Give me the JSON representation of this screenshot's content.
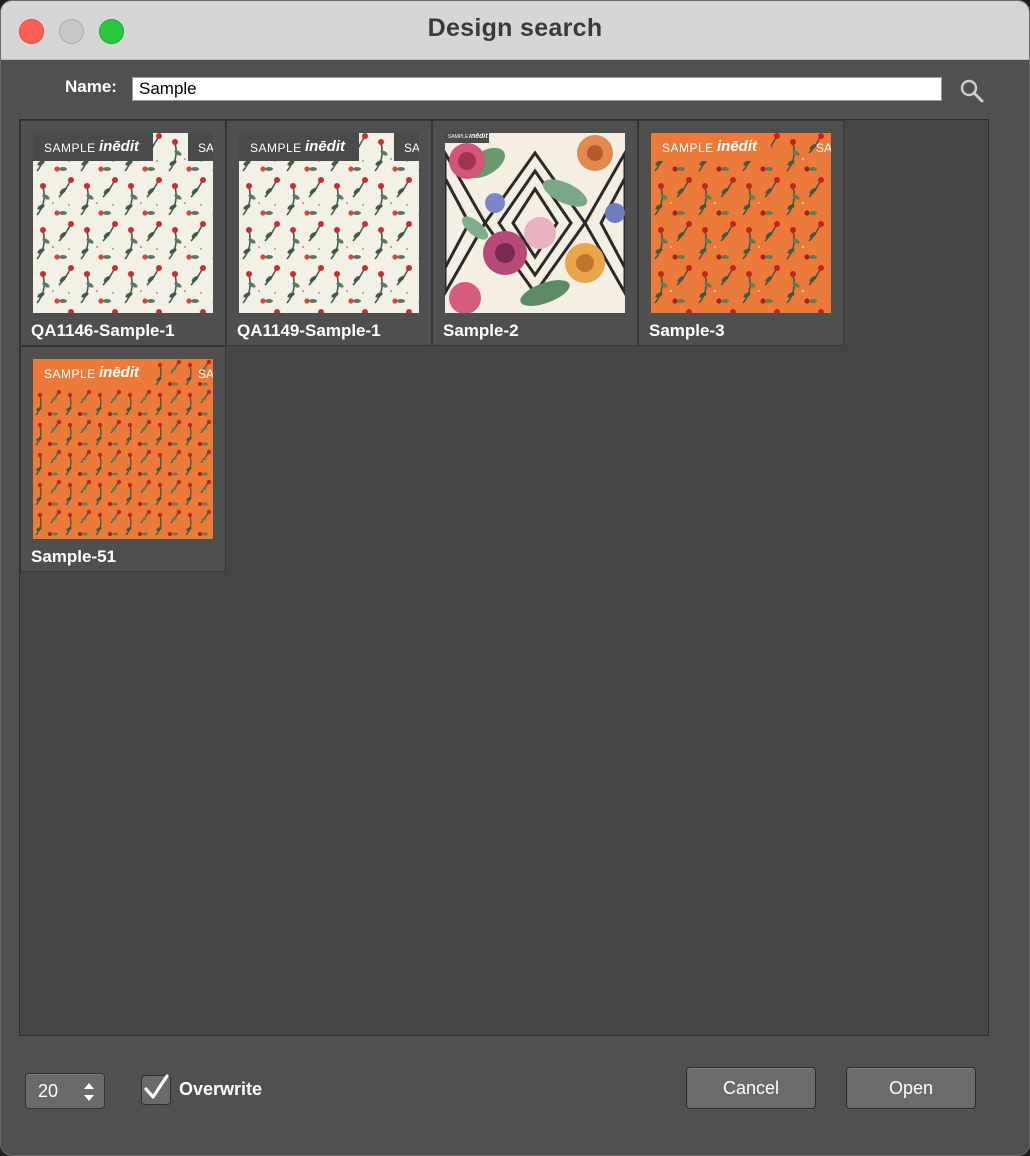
{
  "window": {
    "title": "Design search"
  },
  "search": {
    "label": "Name:",
    "value": "Sample",
    "icon": "magnifier-icon"
  },
  "results": [
    {
      "name": "QA1146-Sample-1",
      "watermark": "SAMPLE",
      "brand": "inēdit",
      "background": "#f3f1e6"
    },
    {
      "name": "QA1149-Sample-1",
      "watermark": "SAMPLE",
      "brand": "inēdit",
      "background": "#f3f1e6"
    },
    {
      "name": "Sample-2",
      "watermark": "SAMPLE",
      "brand": "inēdit",
      "background": "#f4efe2"
    },
    {
      "name": "Sample-3",
      "watermark": "SAMPLE",
      "brand": "inēdit",
      "background": "#ec7a3b"
    },
    {
      "name": "Sample-51",
      "watermark": "SAMPLE",
      "brand": "inēdit",
      "background": "#ec7a3b"
    }
  ],
  "footer": {
    "page_size": "20",
    "overwrite_label": "Overwrite",
    "overwrite_checked": true,
    "cancel_label": "Cancel",
    "open_label": "Open"
  }
}
